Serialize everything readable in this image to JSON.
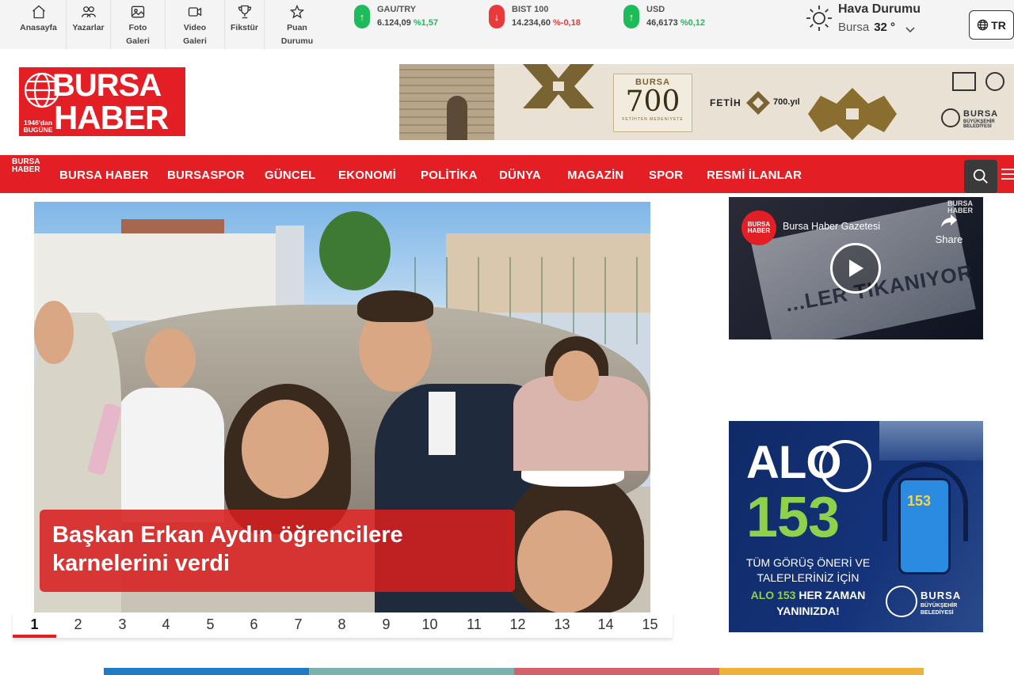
{
  "quick_links": [
    {
      "label": "Anasayfa",
      "icon": "home-icon"
    },
    {
      "label": "Yazarlar",
      "icon": "users-icon"
    },
    {
      "label": "Foto Galeri",
      "icon": "photo-icon"
    },
    {
      "label": "Video Galeri",
      "icon": "video-icon"
    },
    {
      "label": "Fikstür",
      "icon": "trophy-icon"
    },
    {
      "label": "Puan Durumu",
      "icon": "star-icon"
    }
  ],
  "market": [
    {
      "name": "GAU/TRY",
      "value": "6.124,09",
      "change": "%1,57",
      "direction": "up"
    },
    {
      "name": "BIST 100",
      "value": "14.234,60",
      "change": "%-0,18",
      "direction": "down"
    },
    {
      "name": "USD",
      "value": "46,6173",
      "change": "%0,12",
      "direction": "up"
    }
  ],
  "weather": {
    "title": "Hava Durumu",
    "city": "Bursa",
    "temp": "32 °",
    "icon": "sun-icon"
  },
  "language": {
    "label": "TR",
    "icon": "globe-icon"
  },
  "logo": {
    "line1": "BURSA",
    "line2": "HABER",
    "est_line1": "1946'dan",
    "est_line2": "BUGÜNE",
    "mini_line1": "BURSA",
    "mini_line2": "HABER"
  },
  "banner": {
    "city": "BURSA",
    "number": "700",
    "subtitle": "FETİHTEN MEDENİYETE",
    "fetih": "FETİH",
    "fetih_years": "700.yıl",
    "org_line1": "BURSA",
    "org_line2": "BÜYÜKŞEHİR BELEDİYESİ"
  },
  "nav": {
    "items": [
      "BURSA HABER",
      "BURSASPOR",
      "GÜNCEL",
      "EKONOMİ",
      "POLİTİKA",
      "DÜNYA",
      "MAGAZİN",
      "SPOR",
      "RESMİ İLANLAR"
    ]
  },
  "hero": {
    "caption": "Başkan Erkan Aydın öğrencilere karnelerini verdi",
    "active_page": "1",
    "pages": [
      "1",
      "2",
      "3",
      "4",
      "5",
      "6",
      "7",
      "8",
      "9",
      "10",
      "11",
      "12",
      "13",
      "14",
      "15"
    ]
  },
  "video": {
    "channel": "Bursa Haber Gazetesi",
    "share_label": "Share",
    "avatar_line1": "BURSA",
    "avatar_line2": "HABER",
    "corner_line1": "BURSA",
    "corner_line2": "HABER",
    "headline": "...LER TIKANIYOR"
  },
  "ad": {
    "alo": "ALO",
    "number": "153",
    "line1": "TÜM GÖRÜŞ ÖNERİ VE",
    "line2": "TALEPLERİNİZ İÇİN",
    "line3_green": "ALO 153",
    "line3_rest": " HER ZAMAN",
    "line4": "YANINIZDA!",
    "org_line1": "BURSA",
    "org_line2": "BÜYÜKŞEHİR",
    "org_line3": "BELEDİYESİ",
    "phone_number": "153"
  },
  "colors": {
    "brand_red": "#e31e24",
    "up": "#1fbb5a",
    "down": "#e83a3a",
    "strip": [
      "#1f7bc4",
      "#7ab2b0",
      "#d4606c",
      "#f0b13a"
    ]
  }
}
